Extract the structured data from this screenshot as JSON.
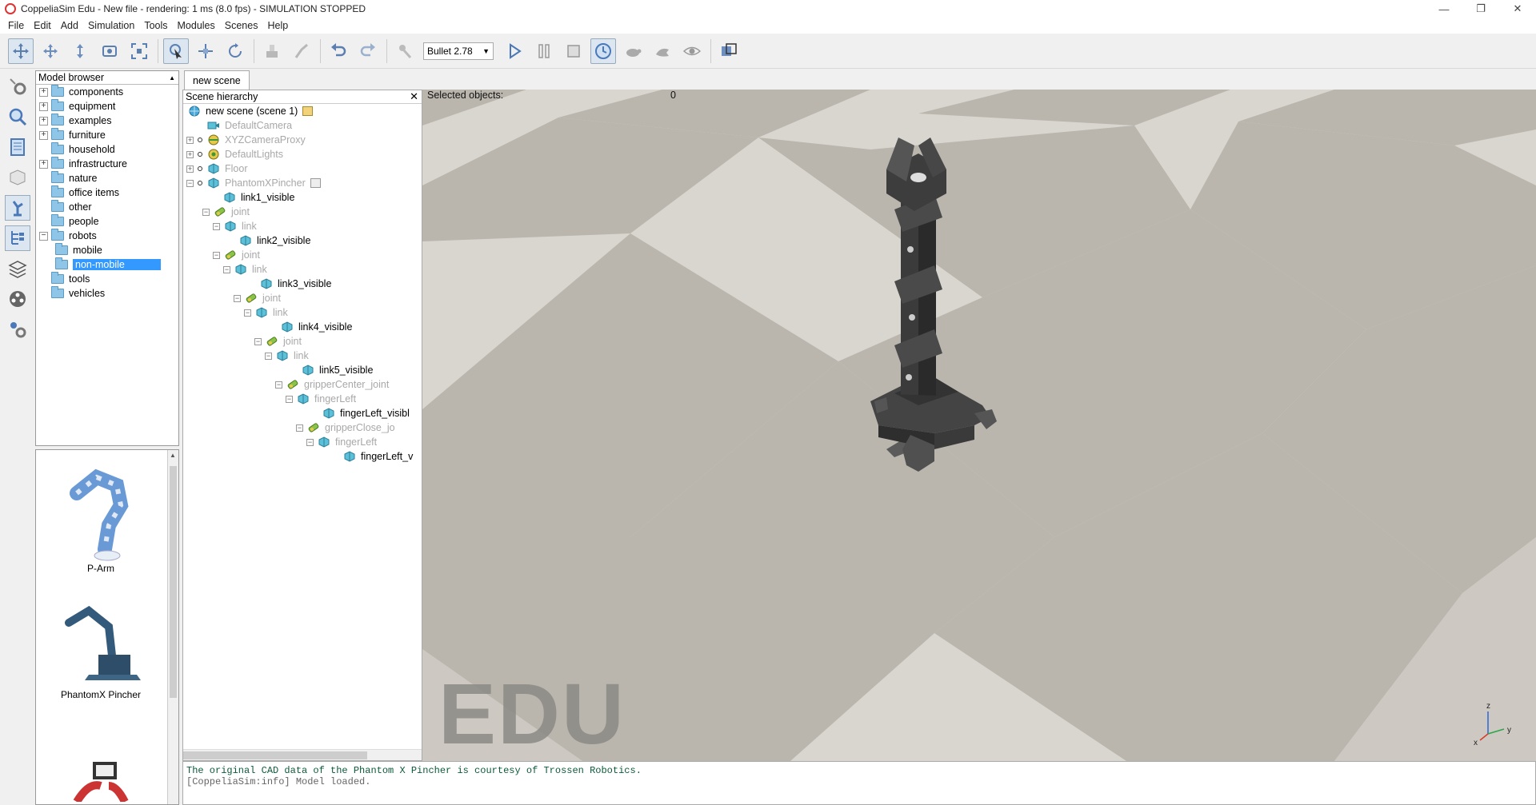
{
  "window": {
    "title": "CoppeliaSim Edu - New file - rendering: 1 ms (8.0 fps) - SIMULATION STOPPED",
    "minimize": "—",
    "restore": "❐",
    "close": "✕"
  },
  "menu": [
    "File",
    "Edit",
    "Add",
    "Simulation",
    "Tools",
    "Modules",
    "Scenes",
    "Help"
  ],
  "toolbar": {
    "engine": "Bullet 2.78",
    "icons": [
      "camera-pan-icon",
      "camera-rotate-icon",
      "camera-shift-icon",
      "camera-angle-icon",
      "fit-to-view-icon",
      "click-select-icon",
      "object-shift-icon",
      "object-rotate-icon",
      "assemble-icon",
      "transfer-dna-icon",
      "undo-icon",
      "redo-icon",
      "engine-settings-icon",
      "play-icon",
      "pause-icon",
      "stop-icon",
      "real-time-icon",
      "slow-down-icon",
      "speed-up-icon",
      "visualization-icon",
      "page-selector-icon"
    ]
  },
  "model_browser": {
    "header": "Model browser",
    "items": [
      {
        "label": "components",
        "expandable": true,
        "depth": 0
      },
      {
        "label": "equipment",
        "expandable": true,
        "depth": 0
      },
      {
        "label": "examples",
        "expandable": true,
        "depth": 0
      },
      {
        "label": "furniture",
        "expandable": true,
        "depth": 0
      },
      {
        "label": "household",
        "expandable": false,
        "depth": 0
      },
      {
        "label": "infrastructure",
        "expandable": true,
        "depth": 0
      },
      {
        "label": "nature",
        "expandable": false,
        "depth": 0
      },
      {
        "label": "office items",
        "expandable": false,
        "depth": 0
      },
      {
        "label": "other",
        "expandable": false,
        "depth": 0
      },
      {
        "label": "people",
        "expandable": false,
        "depth": 0
      },
      {
        "label": "robots",
        "expandable": true,
        "expanded": true,
        "depth": 0
      },
      {
        "label": "mobile",
        "expandable": false,
        "depth": 1
      },
      {
        "label": "non-mobile",
        "expandable": false,
        "depth": 1,
        "selected": true
      },
      {
        "label": "tools",
        "expandable": false,
        "depth": 0
      },
      {
        "label": "vehicles",
        "expandable": false,
        "depth": 0
      }
    ],
    "thumbnails": [
      "P-Arm",
      "PhantomX Pincher"
    ]
  },
  "tabs": [
    "new scene"
  ],
  "scene_hierarchy": {
    "header": "Scene hierarchy",
    "root": "new scene (scene 1)",
    "rows": [
      {
        "label": "DefaultCamera",
        "dim": true,
        "icon": "camera-icon"
      },
      {
        "label": "XYZCameraProxy",
        "dim": true,
        "icon": "dummy-icon"
      },
      {
        "label": "DefaultLights",
        "dim": true,
        "icon": "light-icon"
      },
      {
        "label": "Floor",
        "dim": true,
        "icon": "shape-icon"
      },
      {
        "label": "PhantomXPincher",
        "dim": true,
        "icon": "shape-icon"
      },
      {
        "label": "link1_visible",
        "dim": false,
        "icon": "shape-icon"
      },
      {
        "label": "joint",
        "dim": true,
        "icon": "joint-icon"
      },
      {
        "label": "link",
        "dim": true,
        "icon": "shape-icon"
      },
      {
        "label": "link2_visible",
        "dim": false,
        "icon": "shape-icon"
      },
      {
        "label": "joint",
        "dim": true,
        "icon": "joint-icon"
      },
      {
        "label": "link",
        "dim": true,
        "icon": "shape-icon"
      },
      {
        "label": "link3_visible",
        "dim": false,
        "icon": "shape-icon"
      },
      {
        "label": "joint",
        "dim": true,
        "icon": "joint-icon"
      },
      {
        "label": "link",
        "dim": true,
        "icon": "shape-icon"
      },
      {
        "label": "link4_visible",
        "dim": false,
        "icon": "shape-icon"
      },
      {
        "label": "joint",
        "dim": true,
        "icon": "joint-icon"
      },
      {
        "label": "link",
        "dim": true,
        "icon": "shape-icon"
      },
      {
        "label": "link5_visible",
        "dim": false,
        "icon": "shape-icon"
      },
      {
        "label": "gripperCenter_joint",
        "dim": true,
        "icon": "joint-icon"
      },
      {
        "label": "fingerLeft",
        "dim": true,
        "icon": "shape-icon"
      },
      {
        "label": "fingerLeft_visibl",
        "dim": false,
        "icon": "shape-icon"
      },
      {
        "label": "gripperClose_jo",
        "dim": true,
        "icon": "joint-icon"
      },
      {
        "label": "fingerLeft",
        "dim": true,
        "icon": "shape-icon"
      },
      {
        "label": "fingerLeft_v",
        "dim": false,
        "icon": "shape-icon"
      }
    ]
  },
  "viewport": {
    "selected_label": "Selected objects:",
    "selected_count": "0",
    "watermark": "EDU",
    "axes": {
      "z": "z",
      "y": "y",
      "x": "x"
    }
  },
  "console": {
    "line1": "The original CAD data of the Phantom X Pincher is courtesy of Trossen Robotics.",
    "line2": "[CoppeliaSim:info] Model loaded."
  }
}
